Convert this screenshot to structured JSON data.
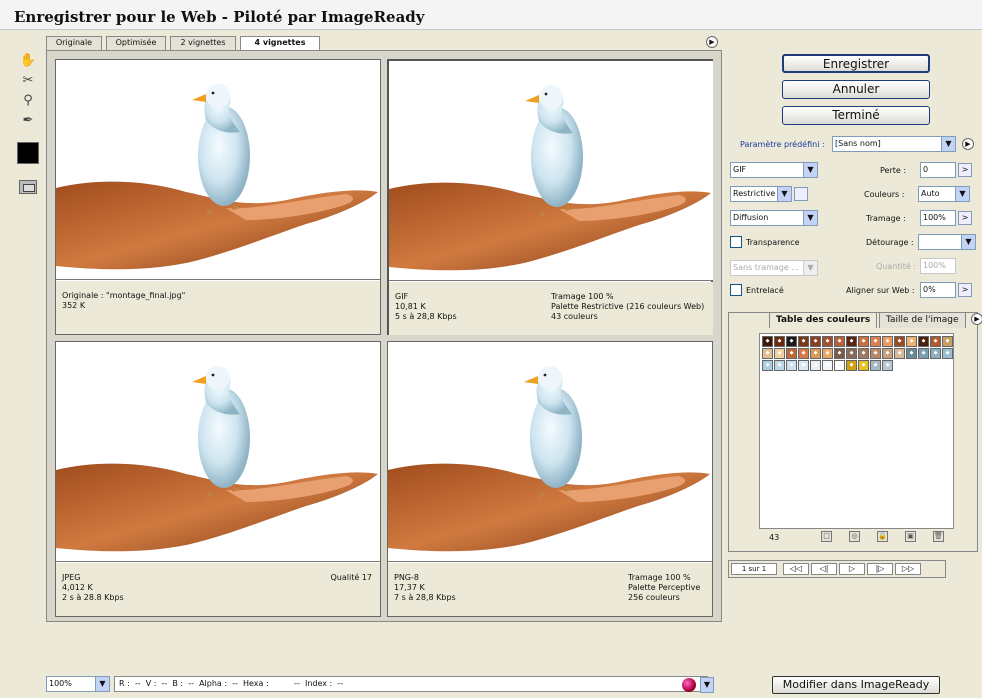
{
  "window": {
    "title": "Enregistrer pour le Web - Piloté par ImageReady"
  },
  "tabs": [
    {
      "label": "Originale"
    },
    {
      "label": "Optimisée"
    },
    {
      "label": "2 vignettes"
    },
    {
      "label": "4 vignettes",
      "active": true
    }
  ],
  "tools": [
    {
      "name": "hand-icon",
      "glyph": "✋"
    },
    {
      "name": "slice-select-icon",
      "glyph": "✂"
    },
    {
      "name": "zoom-icon",
      "glyph": "🔍"
    },
    {
      "name": "eyedropper-icon",
      "glyph": "✒"
    }
  ],
  "eyedropper_color": "#000000",
  "panes": [
    {
      "line1": "Originale : \"montage_final.jpg\"",
      "line2": "352 K",
      "line3": "",
      "right1": "",
      "right2": "",
      "right3": "",
      "selected": false
    },
    {
      "line1": "GIF",
      "line2": "10,81 K",
      "line3": "5 s à 28,8 Kbps",
      "right1": "Tramage 100 %",
      "right2": "Palette Restrictive (216 couleurs Web)",
      "right3": "43 couleurs",
      "selected": true
    },
    {
      "line1": "JPEG",
      "line2": "4,012 K",
      "line3": "2 s à 28.8 Kbps",
      "right1": "Qualité 17",
      "right2": "",
      "right3": "",
      "selected": false
    },
    {
      "line1": "PNG-8",
      "line2": "17,37 K",
      "line3": "7 s à 28,8 Kbps",
      "right1": "Tramage 100 %",
      "right2": "Palette Perceptive",
      "right3": "256 couleurs",
      "selected": false
    }
  ],
  "buttons": {
    "save": "Enregistrer",
    "cancel": "Annuler",
    "done": "Terminé",
    "edit_in": "Modifier dans ImageReady"
  },
  "settings": {
    "preset_label": "Paramètre prédéfini :",
    "preset_value": "[Sans nom]",
    "format": "GIF",
    "palette": "Restrictive (...",
    "dither_algo": "Diffusion",
    "transparency_label": "Transparence",
    "transparency_checked": false,
    "trans_dither": "Sans tramage ...",
    "interlaced_label": "Entrelacé",
    "interlaced_checked": false,
    "lossy_label": "Perte :",
    "lossy_value": "0",
    "colors_label": "Couleurs :",
    "colors_value": "Auto",
    "dither_label": "Tramage :",
    "dither_value": "100%",
    "matte_label": "Détourage :",
    "matte_value": "",
    "amount_label": "Quantité :",
    "amount_value": "100%",
    "websnap_label": "Aligner sur Web :",
    "websnap_value": "0%"
  },
  "color_table": {
    "tab_active": "Table des couleurs",
    "tab_other": "Taille de l'image",
    "count": "43",
    "colors": [
      "#3a1a0a",
      "#6b2a10",
      "#1a1a1a",
      "#7a3a1a",
      "#8a4020",
      "#a05030",
      "#b86038",
      "#5a2510",
      "#c87040",
      "#d88050",
      "#e89a60",
      "#9a4a25",
      "#f0b070",
      "#4a2010",
      "#b05a2a",
      "#caa060",
      "#e0c090",
      "#f0d0a0",
      "#c06838",
      "#d87848",
      "#dc9858",
      "#e8a868",
      "#7a5a4a",
      "#8a6a5a",
      "#a07a60",
      "#b88868",
      "#c8a080",
      "#d8b898",
      "#6a8a9a",
      "#7aa0b0",
      "#8ab0c0",
      "#9ac0d0",
      "#aad0e0",
      "#bad8e8",
      "#cae0ee",
      "#dae8f2",
      "#e8f0f6",
      "#f0f6fa",
      "#ffffff",
      "#d0a010",
      "#e8c020",
      "#a8b8c0",
      "#b8c8d0"
    ]
  },
  "animation": {
    "frame": "1 sur 1"
  },
  "status": {
    "zoom": "100%",
    "readout": "R :  --  V :  --  B :  --  Alpha :  --  Hexa :          --  Index :  --"
  }
}
